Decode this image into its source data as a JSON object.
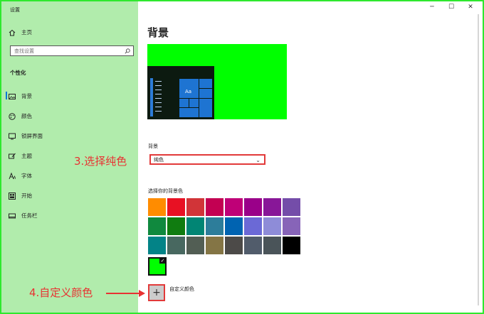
{
  "window": {
    "title": "设置",
    "minimize_icon": "─",
    "maximize_icon": "☐",
    "close_icon": "✕"
  },
  "sidebar": {
    "home_label": "主页",
    "search_placeholder": "查找设置",
    "section_title": "个性化",
    "items": [
      {
        "label": "背景",
        "icon": "picture-icon",
        "active": true
      },
      {
        "label": "颜色",
        "icon": "palette-icon"
      },
      {
        "label": "锁屏界面",
        "icon": "lockscreen-icon"
      },
      {
        "label": "主题",
        "icon": "theme-icon"
      },
      {
        "label": "字体",
        "icon": "font-icon"
      },
      {
        "label": "开始",
        "icon": "start-icon"
      },
      {
        "label": "任务栏",
        "icon": "taskbar-icon"
      }
    ]
  },
  "main": {
    "page_title": "背景",
    "preview_tile_text": "Aa",
    "background_label": "背景",
    "background_value": "纯色",
    "swatch_label": "选择你的背景色",
    "custom_color_label": "自定义颜色",
    "custom_color_icon": "+",
    "check_icon": "✓",
    "selected_color": "#00ff00",
    "swatches": [
      "#ff8c00",
      "#e81123",
      "#d13438",
      "#c30052",
      "#bf0077",
      "#9a0089",
      "#881798",
      "#744da9",
      "#10893e",
      "#107c10",
      "#018574",
      "#2d7d9a",
      "#0063b1",
      "#6b69d6",
      "#8e8cd8",
      "#8764b8",
      "#038387",
      "#486860",
      "#525e54",
      "#847545",
      "#4c4a48",
      "#515c6b",
      "#4a5459",
      "#000000"
    ]
  },
  "annotations": {
    "step3": "3.选择纯色",
    "step4": "4.自定义颜色",
    "highlight_color": "#e23a3a"
  }
}
